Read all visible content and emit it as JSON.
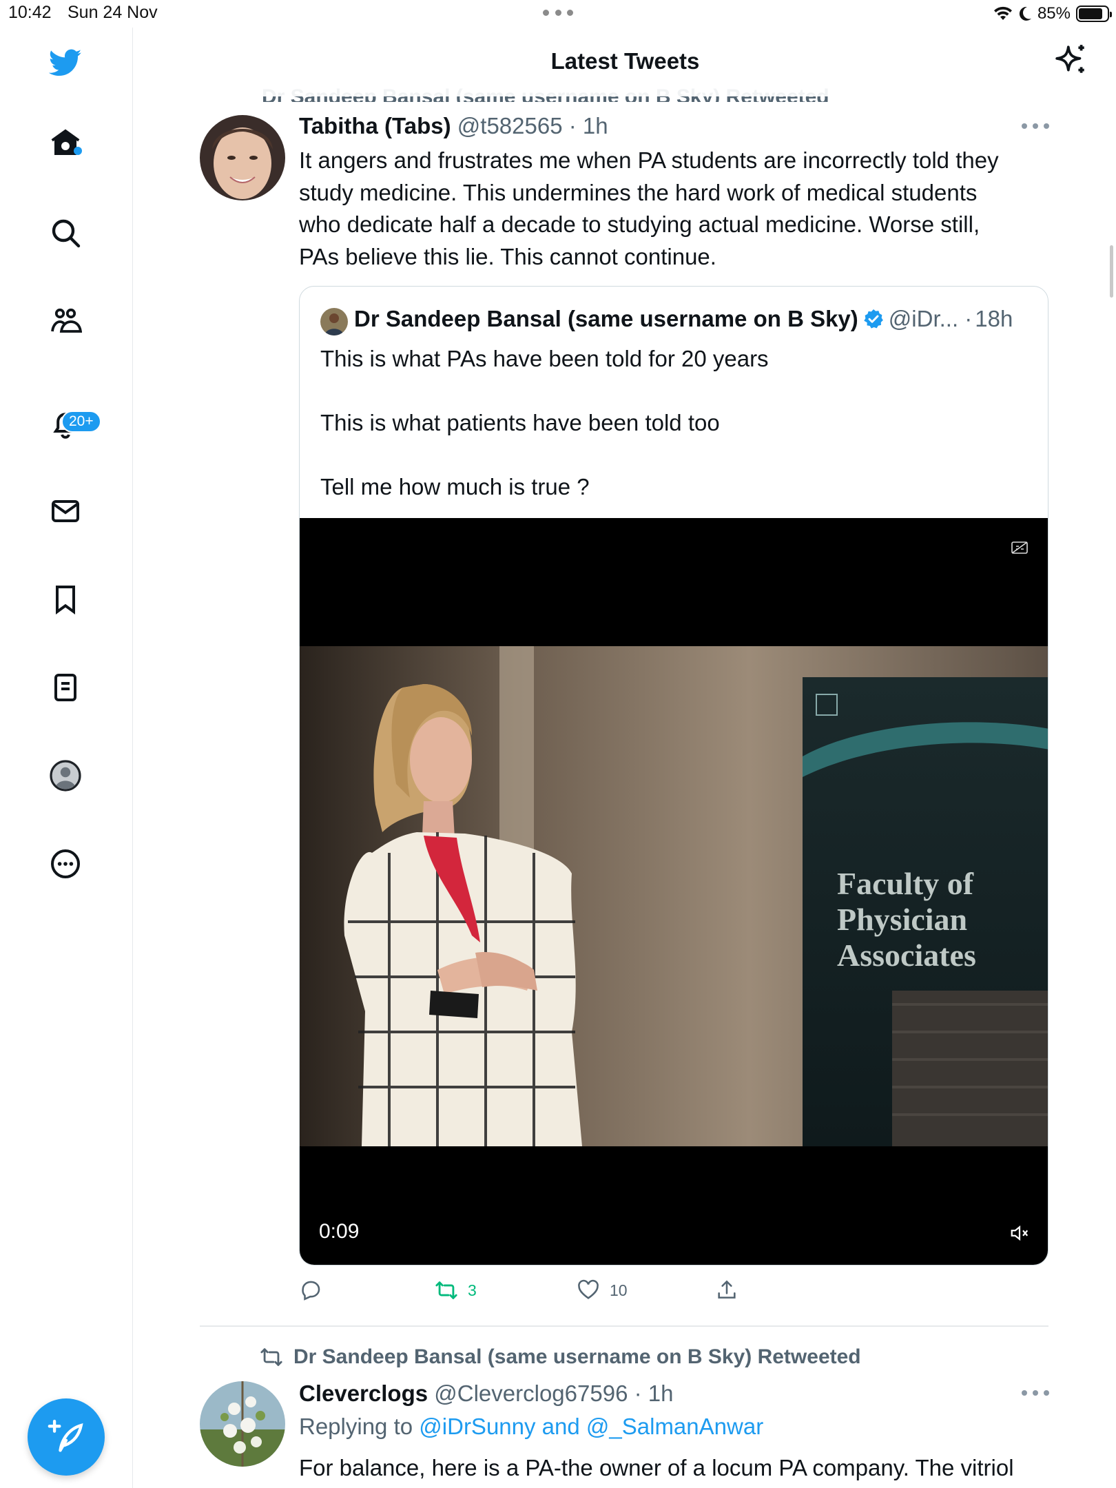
{
  "status_bar": {
    "time": "10:42",
    "date": "Sun 24 Nov",
    "battery": "85%",
    "battery_level": 0.85
  },
  "header": {
    "title": "Latest Tweets",
    "partial_retweet_banner": "Dr Sandeep Bansal (same username on B Sky) Retweeted"
  },
  "sidebar": {
    "items": [
      {
        "name": "home",
        "icon": "home-icon"
      },
      {
        "name": "explore",
        "icon": "search-icon"
      },
      {
        "name": "communities",
        "icon": "communities-icon"
      },
      {
        "name": "notifications",
        "icon": "bell-icon",
        "badge": "20+"
      },
      {
        "name": "messages",
        "icon": "mail-icon"
      },
      {
        "name": "bookmarks",
        "icon": "bookmark-icon"
      },
      {
        "name": "lists",
        "icon": "list-icon"
      },
      {
        "name": "profile",
        "icon": "profile-icon"
      },
      {
        "name": "more",
        "icon": "more-circle-icon"
      }
    ],
    "compose_icon": "compose-icon"
  },
  "tweet1": {
    "name": "Tabitha (Tabs)",
    "handle": "@t582565",
    "sep": "·",
    "time": "1h",
    "text_lines": [
      "It angers and frustrates me when PA students are incorrectly told they",
      "study medicine. This undermines the hard work of medical students",
      "who dedicate half a decade to studying actual medicine. Worse still,",
      "PAs believe this lie. This cannot continue."
    ],
    "quote": {
      "name": "Dr Sandeep Bansal (same username on B Sky)",
      "handle": "@iDr...",
      "sep": "·",
      "time": "18h",
      "lines": [
        "This is what PAs have been told for 20 years",
        "This is what patients have been told too",
        "Tell me how much is true ?"
      ],
      "video": {
        "duration": "0:09",
        "banner_text": [
          "Faculty of",
          "Physician",
          "Associates"
        ]
      }
    },
    "actions": {
      "reply": "",
      "retweets": "3",
      "likes": "10",
      "share": ""
    }
  },
  "tweet2": {
    "retweeted_by": "Dr Sandeep Bansal (same username on B Sky) Retweeted",
    "name": "Cleverclogs",
    "handle": "@Cleverclog67596",
    "sep": "·",
    "time": "1h",
    "replying_prefix": "Replying to",
    "replying_to": "@iDrSunny and @_SalmanAnwar",
    "text": "For balance, here is a PA-the owner of a locum PA company. The vitriol"
  },
  "colors": {
    "accent": "#1d9bf0",
    "retweet_green": "#00ba7c",
    "secondary_text": "#536471"
  }
}
